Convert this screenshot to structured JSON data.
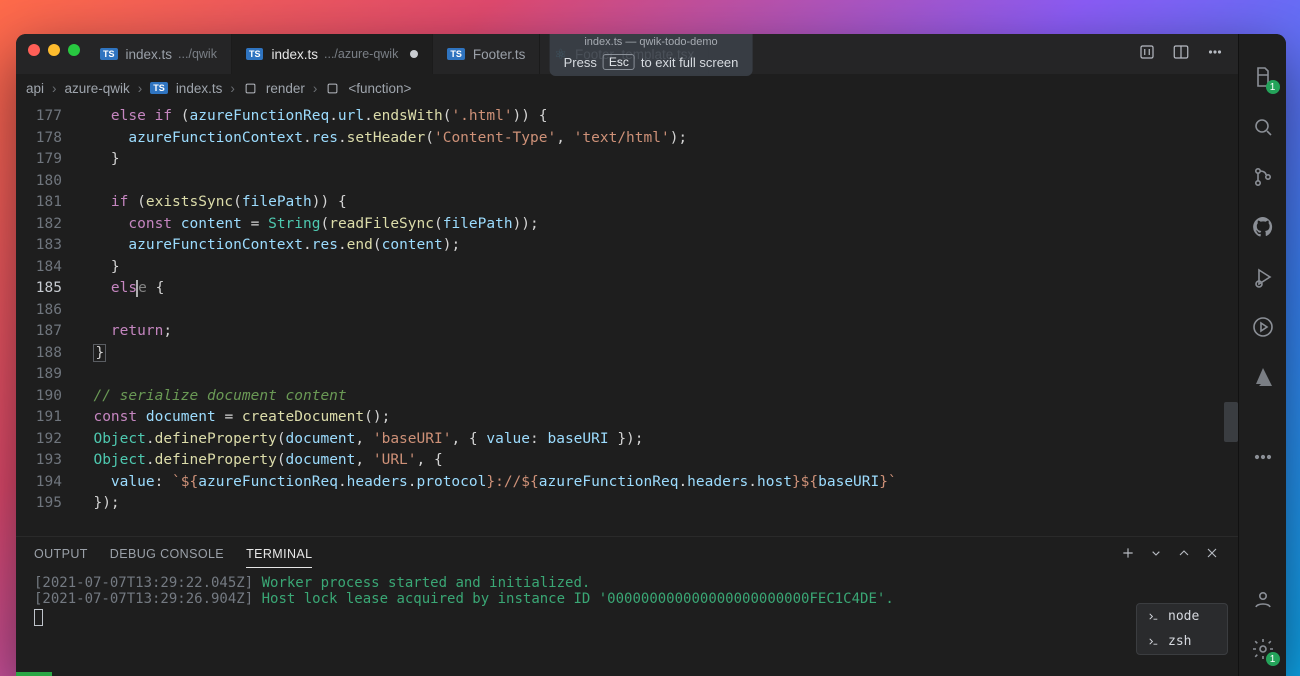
{
  "app_title": "index.ts — qwik-todo-demo",
  "fullscreen_hint": {
    "press": "Press",
    "key": "Esc",
    "rest": "to exit full screen"
  },
  "tabs": [
    {
      "icon": "ts",
      "name": "index.ts",
      "detail": ".../qwik",
      "active": false,
      "dirty": false
    },
    {
      "icon": "ts",
      "name": "index.ts",
      "detail": ".../azure-qwik",
      "active": true,
      "dirty": true
    },
    {
      "icon": "ts",
      "name": "Footer.ts",
      "detail": "",
      "active": false,
      "dirty": false
    },
    {
      "icon": "react",
      "name": "Footer_template.tsx",
      "detail": "",
      "active": false,
      "dirty": false
    }
  ],
  "breadcrumb": [
    "api",
    "azure-qwik",
    "index.ts",
    "render",
    "<function>"
  ],
  "line_start": 177,
  "current_line": 185,
  "code_lines": [
    {
      "html": "    <span class='k'>else if</span> <span class='p'>(</span><span class='v'>azureFunctionReq</span><span class='p'>.</span><span class='v'>url</span><span class='p'>.</span><span class='fn'>endsWith</span><span class='p'>(</span><span class='s'>'.html'</span><span class='p'>)) {</span>"
    },
    {
      "html": "      <span class='v'>azureFunctionContext</span><span class='p'>.</span><span class='v'>res</span><span class='p'>.</span><span class='fn'>setHeader</span><span class='p'>(</span><span class='s'>'Content-Type'</span><span class='p'>, </span><span class='s'>'text/html'</span><span class='p'>);</span>"
    },
    {
      "html": "    <span class='p'>}</span>"
    },
    {
      "html": ""
    },
    {
      "html": "    <span class='k'>if</span> <span class='p'>(</span><span class='fn'>existsSync</span><span class='p'>(</span><span class='v'>filePath</span><span class='p'>)) {</span>"
    },
    {
      "html": "      <span class='k'>const</span> <span class='v'>content</span> <span class='p'>=</span> <span class='t'>String</span><span class='p'>(</span><span class='fn'>readFileSync</span><span class='p'>(</span><span class='v'>filePath</span><span class='p'>));</span>"
    },
    {
      "html": "      <span class='v'>azureFunctionContext</span><span class='p'>.</span><span class='v'>res</span><span class='p'>.</span><span class='fn'>end</span><span class='p'>(</span><span class='v'>content</span><span class='p'>);</span>"
    },
    {
      "html": "    <span class='p'>}</span>"
    },
    {
      "html": "    <span class='k'>els</span><span class='cursor'></span><span class='p' style='opacity:.55'>e</span> <span class='p'>{</span>"
    },
    {
      "html": ""
    },
    {
      "html": "    <span class='k'>return</span><span class='p'>;</span>"
    },
    {
      "html": "  <span class='p' style='border:1px solid #5a5d62;padding:0 1px'>}</span>"
    },
    {
      "html": ""
    },
    {
      "html": "  <span class='c'>// serialize document content</span>"
    },
    {
      "html": "  <span class='k'>const</span> <span class='v'>document</span> <span class='p'>=</span> <span class='fn'>createDocument</span><span class='p'>();</span>"
    },
    {
      "html": "  <span class='t'>Object</span><span class='p'>.</span><span class='fn'>defineProperty</span><span class='p'>(</span><span class='v'>document</span><span class='p'>, </span><span class='s'>'baseURI'</span><span class='p'>, { </span><span class='v'>value</span><span class='p'>: </span><span class='v'>baseURI</span><span class='p'> });</span>"
    },
    {
      "html": "  <span class='t'>Object</span><span class='p'>.</span><span class='fn'>defineProperty</span><span class='p'>(</span><span class='v'>document</span><span class='p'>, </span><span class='s'>'URL'</span><span class='p'>, {</span>"
    },
    {
      "html": "    <span class='v'>value</span><span class='p'>: </span><span class='s'>`${</span><span class='v'>azureFunctionReq</span><span class='p'>.</span><span class='v'>headers</span><span class='p'>.</span><span class='v'>protocol</span><span class='s'>}://${</span><span class='v'>azureFunctionReq</span><span class='p'>.</span><span class='v'>headers</span><span class='p'>.</span><span class='v'>host</span><span class='s'>}${</span><span class='v'>baseURI</span><span class='s'>}`</span>"
    },
    {
      "html": "  <span class='p'>});</span>"
    }
  ],
  "panel": {
    "tabs": [
      "OUTPUT",
      "DEBUG CONSOLE",
      "TERMINAL"
    ],
    "active": 2,
    "profiles": [
      "node",
      "zsh"
    ],
    "lines": [
      {
        "ts": "[2021-07-07T13:29:22.045Z]",
        "msg": "Worker process started and initialized."
      },
      {
        "ts": "[2021-07-07T13:29:26.904Z]",
        "msg": "Host lock lease acquired by instance ID '000000000000000000000000FEC1C4DE'."
      }
    ]
  },
  "activity_badges": {
    "explorer": "1",
    "settings": "1"
  }
}
